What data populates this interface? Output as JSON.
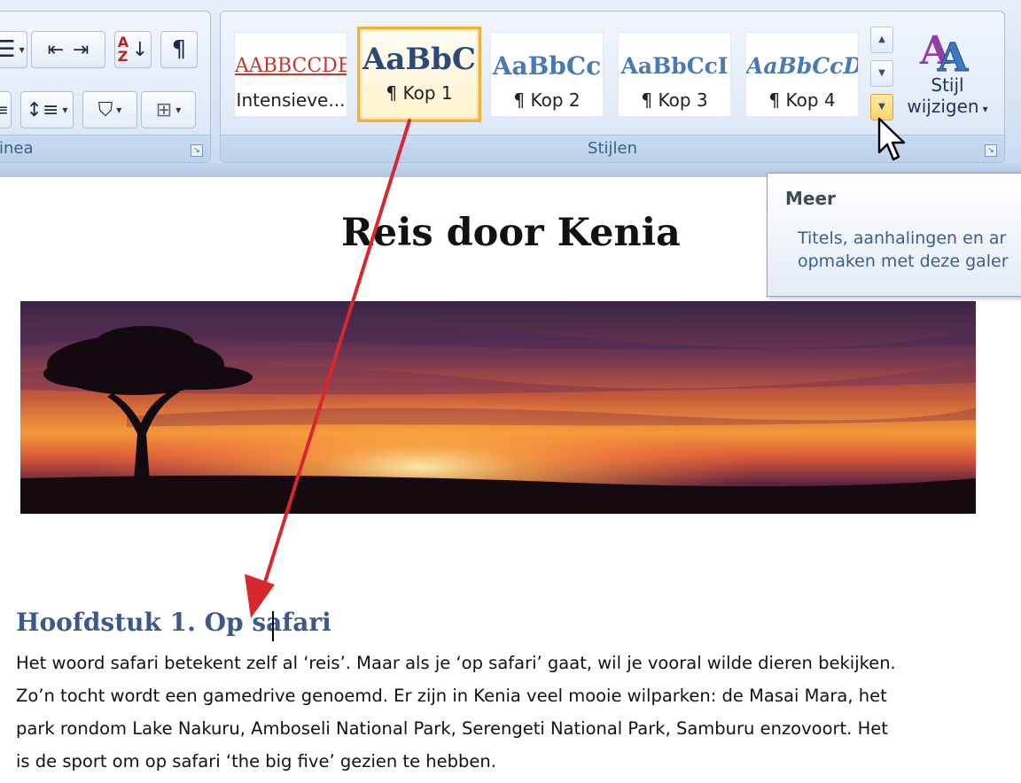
{
  "ribbon": {
    "paragraph_group": {
      "label": "inea",
      "buttons": [
        "decrease-indent",
        "increase-indent",
        "sort",
        "show-marks",
        "line-spacing",
        "shading",
        "borders"
      ],
      "sort_label": "AZ",
      "pilcrow": "¶"
    },
    "styles_group": {
      "label": "Stijlen",
      "items": [
        {
          "preview": "AABBCCDE",
          "name": "Intensieve...",
          "color": "#c0392b",
          "selected": false
        },
        {
          "preview": "AaBbC",
          "name": "¶ Kop 1",
          "color": "#2b4a78",
          "selected": true
        },
        {
          "preview": "AaBbCc",
          "name": "¶ Kop 2",
          "color": "#4a7ab3",
          "selected": false
        },
        {
          "preview": "AaBbCcI",
          "name": "¶ Kop 3",
          "color": "#4a7ab3",
          "selected": false
        },
        {
          "preview": "AaBbCcD",
          "name": "¶ Kop 4",
          "color": "#4a7ab3",
          "selected": false
        }
      ],
      "change_styles": {
        "line1": "Stijl",
        "line2": "wijzigen",
        "icon_text": "AA"
      }
    }
  },
  "tooltip": {
    "title": "Meer",
    "description": "Titels, aanhalingen en ar\nopmaken met deze galer"
  },
  "document": {
    "title": "Reis door Kenia",
    "heading": "Hoofdstuk 1. Op safari",
    "paragraph_lines": [
      "Het woord safari betekent zelf al ‘reis’. Maar als je ‘op safari’ gaat, wil je vooral wilde dieren bekijken.",
      "Zo’n tocht wordt een gamedrive genoemd. Er zijn in Kenia veel mooie wilparken: de Masai Mara, het",
      "park rondom Lake Nakuru, Amboseli National Park, Serengeti National Park, Samburu enzovoort.  Het",
      "is de sport om op safari ‘the big five’ gezien te hebben."
    ],
    "image": "sunset-acacia-savanna"
  },
  "colors": {
    "ribbon": "#dce7f5",
    "selected_style": "#f0b33a",
    "heading": "#3c5a89",
    "annotation_arrow": "#d9272e"
  }
}
